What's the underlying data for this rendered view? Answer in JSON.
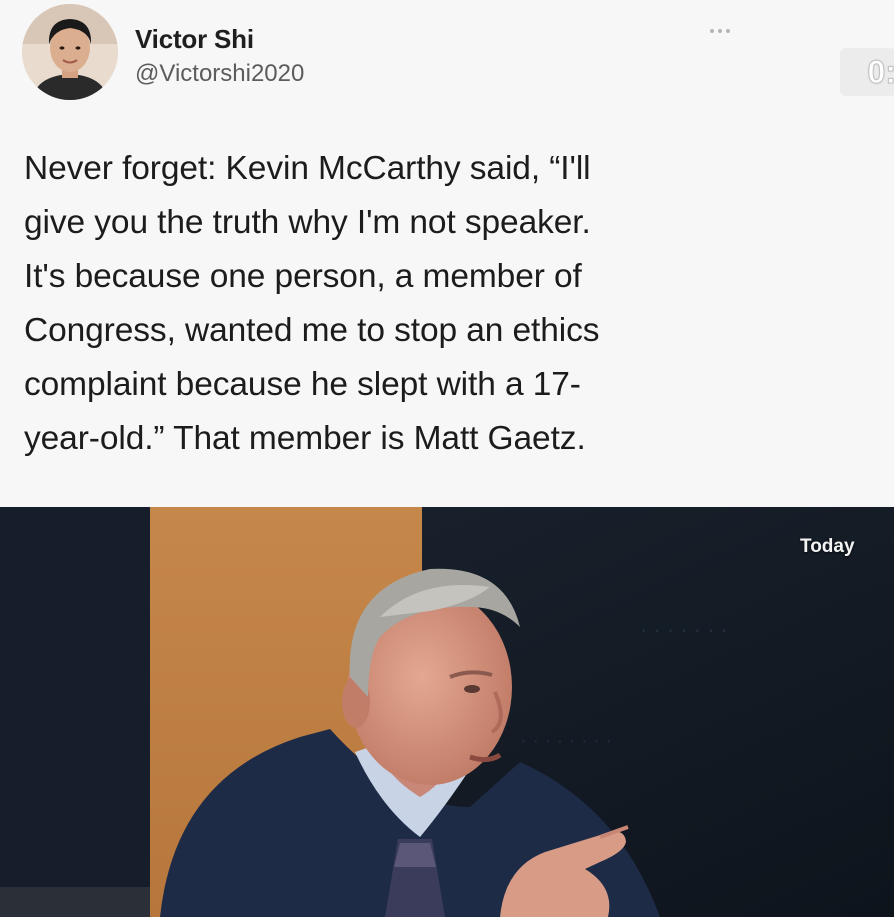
{
  "tweet": {
    "author_name": "Victor Shi",
    "author_handle": "@Victorshi2020",
    "text": "Never forget: Kevin McCarthy said, “I'll\ngive you the truth why I'm not speaker.\nIt's because one person, a member of\nCongress, wanted me to stop an ethics\ncomplaint because he slept with a 17-\nyear-old.” That member is Matt Gaetz.",
    "more_icon": "more-horizontal-icon",
    "corner_badge": "0:"
  },
  "media": {
    "overlay_label": "Today",
    "colors": {
      "backdrop_left": "#16202d",
      "backdrop_panel": "#c98a4a",
      "suit": "#1c2a44",
      "skin": "#d99a84",
      "hair": "#a9a9a4"
    }
  }
}
